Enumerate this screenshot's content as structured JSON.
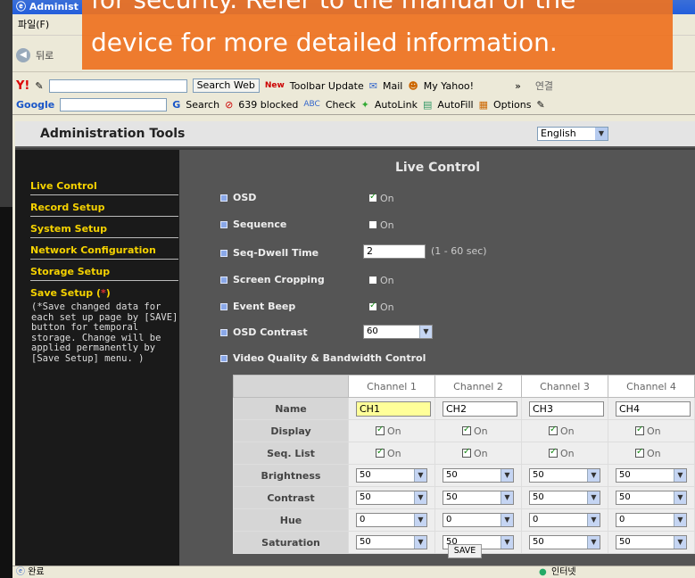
{
  "window": {
    "title": "Administ",
    "status_done": "완료",
    "status_zone": "인터넷"
  },
  "banner": {
    "line1": "for security. Refer to the manual of the",
    "line2": "device for more detailed information."
  },
  "menu": {
    "file": "파일(F)",
    "back": "뒤로"
  },
  "yahoo_bar": {
    "logo": "Y!",
    "search_button": "Search Web",
    "toolbar_update": "Toolbar Update",
    "new_badge": "New",
    "mail": "Mail",
    "my_yahoo": "My Yahoo!",
    "links": "연결"
  },
  "google_bar": {
    "logo": "Google",
    "search": "Search",
    "blocked": "639 blocked",
    "check": "Check",
    "autolink": "AutoLink",
    "autofill": "AutoFill",
    "options": "Options"
  },
  "header": {
    "title": "Administration Tools",
    "language": "English"
  },
  "sidebar": {
    "items": [
      {
        "label": "Live Control"
      },
      {
        "label": "Record Setup"
      },
      {
        "label": "System Setup"
      },
      {
        "label": "Network Configuration"
      },
      {
        "label": "Storage Setup"
      },
      {
        "label": "Save Setup ("
      }
    ],
    "save_mark": "*",
    "save_close": ")",
    "note": "(*Save changed data for each set up page by [SAVE] button for temporal storage. Change will be applied permanently by [Save Setup] menu. )"
  },
  "live": {
    "title": "Live Control",
    "osd_label": "OSD",
    "osd_on": "On",
    "sequence_label": "Sequence",
    "sequence_on": "On",
    "dwell_label": "Seq-Dwell Time",
    "dwell_value": "2",
    "dwell_range": "(1 - 60 sec)",
    "crop_label": "Screen Cropping",
    "crop_on": "On",
    "beep_label": "Event Beep",
    "beep_on": "On",
    "contrast_label": "OSD Contrast",
    "contrast_value": "60",
    "video_label": "Video Quality & Bandwidth Control"
  },
  "grid": {
    "channels": [
      "Channel 1",
      "Channel 2",
      "Channel 3",
      "Channel 4"
    ],
    "row_labels": {
      "name": "Name",
      "display": "Display",
      "seq": "Seq. List",
      "brightness": "Brightness",
      "contrast": "Contrast",
      "hue": "Hue",
      "saturation": "Saturation"
    },
    "names": [
      "CH1",
      "CH2",
      "CH3",
      "CH4"
    ],
    "on_label": "On",
    "brightness": [
      "50",
      "50",
      "50",
      "50"
    ],
    "contrast": [
      "50",
      "50",
      "50",
      "50"
    ],
    "hue": [
      "0",
      "0",
      "0",
      "0"
    ],
    "saturation": [
      "50",
      "50",
      "50",
      "50"
    ]
  },
  "save_button": "SAVE"
}
